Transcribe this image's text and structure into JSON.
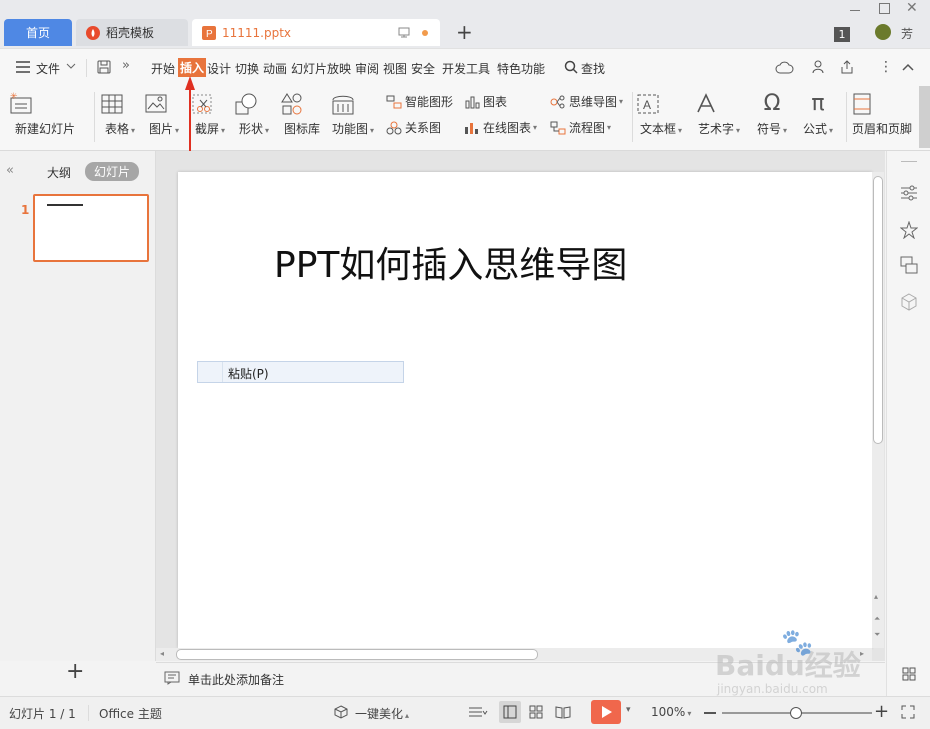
{
  "tabs": {
    "home": "首页",
    "template": "稻壳模板",
    "file": "11111.pptx",
    "new_tab": "+"
  },
  "window": {
    "badge": "1",
    "user_name": "芳"
  },
  "menu": {
    "file": "文件",
    "items": [
      "开始",
      "插入",
      "设计",
      "切换",
      "动画",
      "幻灯片放映",
      "审阅",
      "视图",
      "安全",
      "开发工具",
      "特色功能"
    ],
    "search": "查找"
  },
  "ribbon": {
    "new_slide": "新建幻灯片",
    "table": "表格",
    "picture": "图片",
    "screenshot": "截屏",
    "shape": "形状",
    "icon_lib": "图标库",
    "func_chart": "功能图",
    "smart_shape": "智能图形",
    "chart": "图表",
    "relation": "关系图",
    "online_chart": "在线图表",
    "mindmap": "思维导图",
    "flowchart": "流程图",
    "textbox": "文本框",
    "wordart": "艺术字",
    "symbol": "符号",
    "formula": "公式",
    "header_footer": "页眉和页脚"
  },
  "left_panel": {
    "outline": "大纲",
    "slides": "幻灯片",
    "slide_number": "1",
    "add": "+"
  },
  "slide": {
    "title": "PPT如何插入思维导图",
    "paste_menu": "粘贴(P)"
  },
  "notes": {
    "placeholder": "单击此处添加备注"
  },
  "status": {
    "slide_count": "幻灯片 1 / 1",
    "theme": "Office 主题",
    "beautify": "一键美化",
    "zoom": "100%"
  },
  "watermark": {
    "brand": "Baidu经验",
    "url": "jingyan.baidu.com"
  },
  "colors": {
    "accent": "#e8743c",
    "home_tab": "#4f88e4",
    "active_menu_bg": "#e8743c",
    "play_button": "#f0674c"
  }
}
